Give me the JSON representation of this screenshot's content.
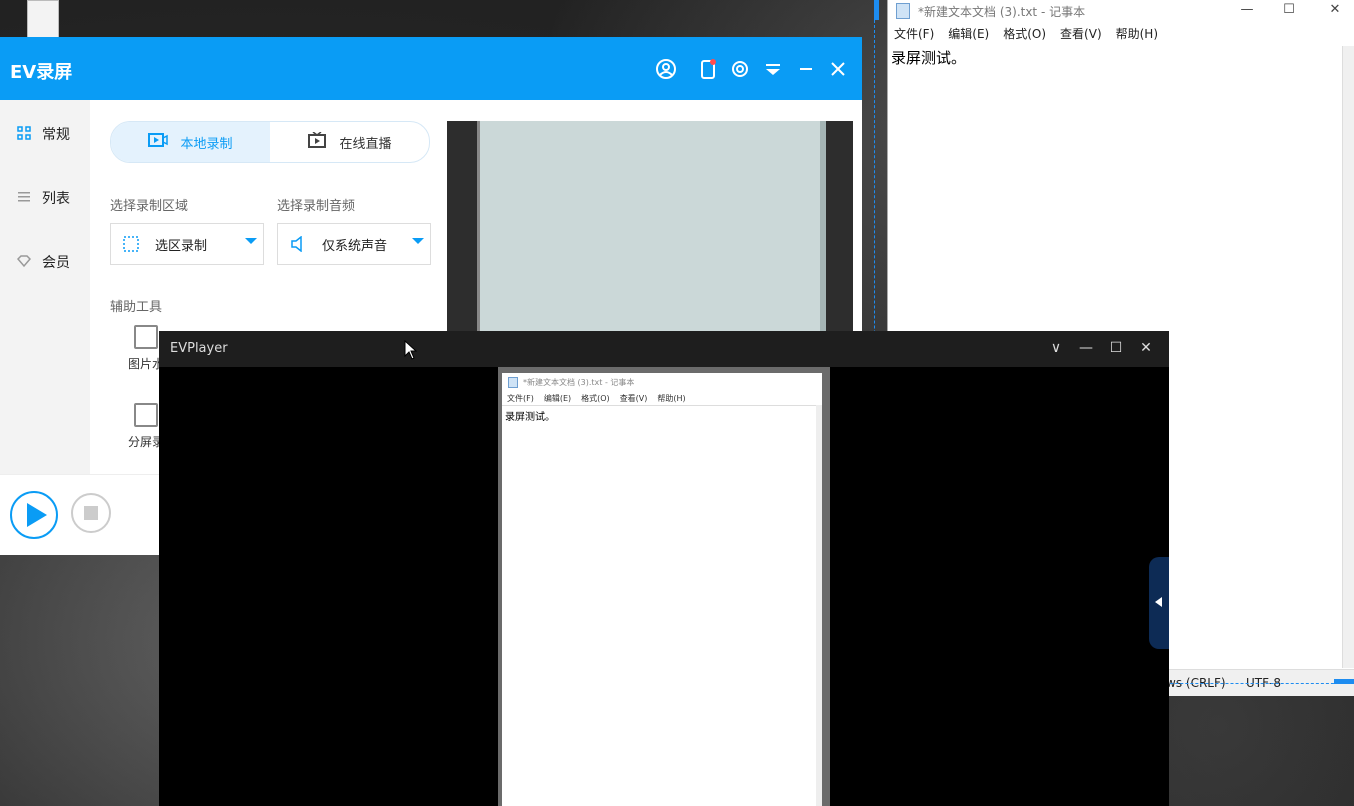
{
  "notepad": {
    "title": "*新建文本文档 (3).txt - 记事本",
    "menu": [
      "文件(F)",
      "编辑(E)",
      "格式(O)",
      "查看(V)",
      "帮助(H)"
    ],
    "content": "录屏测试。",
    "status_line_ending": "ws (CRLF)",
    "status_encoding": "UTF-8",
    "controls": {
      "minimize": "—",
      "maximize": "☐",
      "close": "✕"
    }
  },
  "ev": {
    "title": "EV录屏",
    "sidebar": [
      {
        "label": "常规",
        "icon": "grid-icon"
      },
      {
        "label": "列表",
        "icon": "list-icon"
      },
      {
        "label": "会员",
        "icon": "diamond-icon"
      }
    ],
    "tabs": {
      "local": "本地录制",
      "live": "在线直播"
    },
    "area_label": "选择录制区域",
    "audio_label": "选择录制音频",
    "area_value": "选区录制",
    "audio_value": "仅系统声音",
    "tools_label": "辅助工具",
    "tool_image": "图片水",
    "tool_split": "分屏录",
    "accent": "#0a9cf5"
  },
  "player": {
    "title": "EVPlayer",
    "controls": {
      "dropdown": "∨",
      "minimize": "—",
      "maximize": "☐",
      "close": "✕"
    },
    "mini_title": "*新建文本文档 (3).txt - 记事本",
    "mini_menu": [
      "文件(F)",
      "编辑(E)",
      "格式(O)",
      "查看(V)",
      "帮助(H)"
    ],
    "mini_content": "录屏测试。"
  }
}
